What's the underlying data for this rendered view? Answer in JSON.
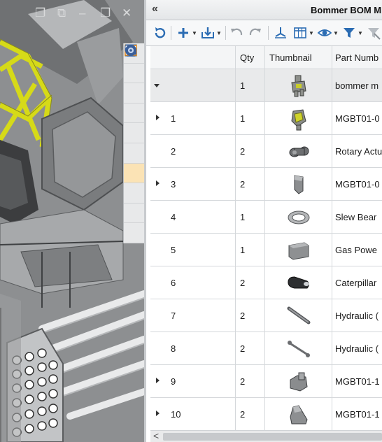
{
  "window": {
    "controls": {
      "restore_a": "❐",
      "restore_b": "⧉",
      "minimize": "–",
      "maximize": "❐",
      "close": "✕"
    }
  },
  "task_pane": {
    "tabs": [
      {
        "icon": "home-icon"
      },
      {
        "icon": "design-library-icon"
      },
      {
        "icon": "folder-icon"
      },
      {
        "icon": "view-palette-icon"
      },
      {
        "icon": "appearances-icon"
      },
      {
        "icon": "custom-properties-icon"
      },
      {
        "icon": "bom-icon",
        "active": true
      },
      {
        "icon": "sync-icon"
      },
      {
        "icon": "forum-icon"
      },
      {
        "icon": "3d-content-icon"
      }
    ]
  },
  "bom": {
    "collapse_label": "«",
    "title": "Bommer BOM M",
    "toolbar": [
      {
        "icon": "refresh-icon"
      },
      {
        "icon": "add-icon",
        "dropdown": true
      },
      {
        "icon": "export-icon",
        "dropdown": true
      },
      {
        "icon": "undo-icon"
      },
      {
        "icon": "redo-icon"
      },
      {
        "icon": "level-icon"
      },
      {
        "icon": "columns-icon",
        "dropdown": true
      },
      {
        "icon": "visibility-icon",
        "dropdown": true
      },
      {
        "icon": "filter-icon",
        "dropdown": true
      },
      {
        "icon": "clear-filter-icon"
      }
    ],
    "columns": {
      "item": "",
      "qty": "Qty",
      "thumbnail": "Thumbnail",
      "part_number": "Part Numb"
    },
    "rows": [
      {
        "item": "",
        "qty": "1",
        "part": "bommer m",
        "expander": "down",
        "thumb": "assembly"
      },
      {
        "item": "1",
        "qty": "1",
        "part": "MGBT01-0",
        "expander": "right",
        "thumb": "mgbt-assembly"
      },
      {
        "item": "2",
        "qty": "2",
        "part": "Rotary Actu",
        "expander": "",
        "thumb": "rotary-actuator"
      },
      {
        "item": "3",
        "qty": "2",
        "part": "MGBT01-0",
        "expander": "right",
        "thumb": "bracket"
      },
      {
        "item": "4",
        "qty": "1",
        "part": "Slew Bear",
        "expander": "",
        "thumb": "ring"
      },
      {
        "item": "5",
        "qty": "1",
        "part": "Gas Powe",
        "expander": "",
        "thumb": "box"
      },
      {
        "item": "6",
        "qty": "2",
        "part": "Caterpillar",
        "expander": "",
        "thumb": "track"
      },
      {
        "item": "7",
        "qty": "2",
        "part": "Hydraulic (",
        "expander": "",
        "thumb": "cylinder"
      },
      {
        "item": "8",
        "qty": "2",
        "part": "Hydraulic (",
        "expander": "",
        "thumb": "rod"
      },
      {
        "item": "9",
        "qty": "2",
        "part": "MGBT01-1",
        "expander": "right",
        "thumb": "block-bracket"
      },
      {
        "item": "10",
        "qty": "2",
        "part": "MGBT01-1",
        "expander": "right",
        "thumb": "angle-bracket"
      }
    ],
    "scroll_left": "<"
  },
  "colors": {
    "accent_yellow": "#c9cc1c",
    "bom_tab_active": "#fbe3b5",
    "toolbar_blue": "#2b6cb3"
  }
}
